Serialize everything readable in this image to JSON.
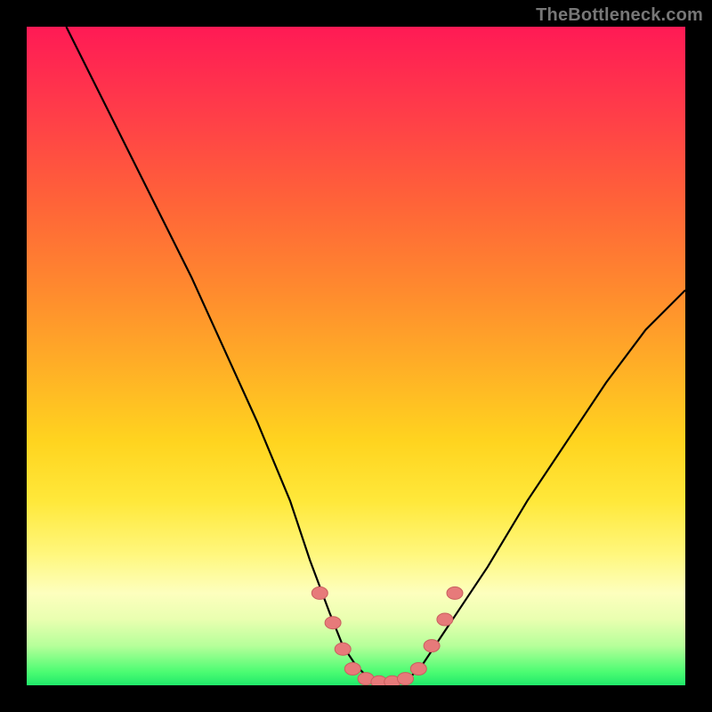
{
  "watermark": "TheBottleneck.com",
  "chart_data": {
    "type": "line",
    "title": "",
    "xlabel": "",
    "ylabel": "",
    "xlim": [
      0,
      100
    ],
    "ylim": [
      0,
      100
    ],
    "grid": false,
    "legend": false,
    "series": [
      {
        "name": "bottleneck-curve",
        "x": [
          6,
          10,
          15,
          20,
          25,
          30,
          35,
          40,
          43,
          46,
          48,
          50,
          52,
          54,
          56,
          58,
          60,
          64,
          70,
          76,
          82,
          88,
          94,
          100
        ],
        "y": [
          100,
          92,
          82,
          72,
          62,
          51,
          40,
          28,
          19,
          11,
          6,
          3,
          1,
          0.5,
          0.5,
          1,
          3,
          9,
          18,
          28,
          37,
          46,
          54,
          60
        ]
      }
    ],
    "markers": [
      {
        "x": 44.5,
        "y": 14
      },
      {
        "x": 46.5,
        "y": 9.5
      },
      {
        "x": 48,
        "y": 5.5
      },
      {
        "x": 49.5,
        "y": 2.5
      },
      {
        "x": 51.5,
        "y": 1
      },
      {
        "x": 53.5,
        "y": 0.5
      },
      {
        "x": 55.5,
        "y": 0.5
      },
      {
        "x": 57.5,
        "y": 1
      },
      {
        "x": 59.5,
        "y": 2.5
      },
      {
        "x": 61.5,
        "y": 6
      },
      {
        "x": 63.5,
        "y": 10
      },
      {
        "x": 65,
        "y": 14
      }
    ],
    "colors": {
      "curve": "#000000",
      "marker_fill": "#e77a7a",
      "marker_stroke": "#c95f5f"
    }
  }
}
